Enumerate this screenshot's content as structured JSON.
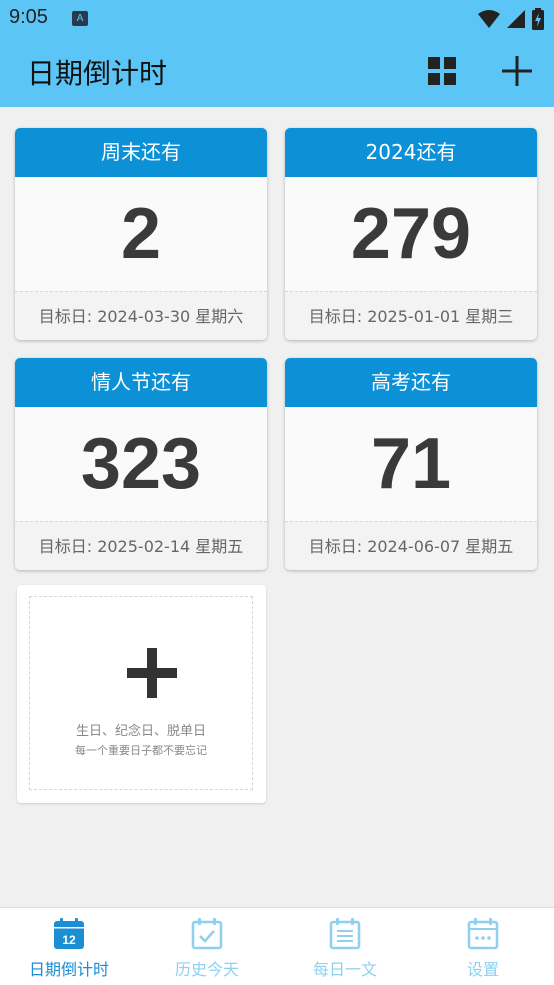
{
  "status": {
    "time": "9:05",
    "notif_badge": "A"
  },
  "appbar": {
    "title": "日期倒计时",
    "grid_icon": "grid-view-icon",
    "add_icon": "plus-icon"
  },
  "colors": {
    "header": "#5bc6f6",
    "card_head": "#0c90d6",
    "number": "#3a3a3a",
    "nav_active": "#1a8fd4",
    "nav_inactive": "#8fd0f0"
  },
  "cards": [
    {
      "title": "周末还有",
      "days": "2",
      "target": "目标日: 2024-03-30 星期六"
    },
    {
      "title": "2024还有",
      "days": "279",
      "target": "目标日: 2025-01-01 星期三"
    },
    {
      "title": "情人节还有",
      "days": "323",
      "target": "目标日: 2025-02-14 星期五"
    },
    {
      "title": "高考还有",
      "days": "71",
      "target": "目标日: 2024-06-07 星期五"
    }
  ],
  "add_card": {
    "line1": "生日、纪念日、脱单日",
    "line2": "每一个重要日子都不要忘记"
  },
  "nav": [
    {
      "label": "日期倒计时",
      "icon": "calendar-12-icon",
      "active": true,
      "badge": "12"
    },
    {
      "label": "历史今天",
      "icon": "calendar-check-icon",
      "active": false
    },
    {
      "label": "每日一文",
      "icon": "calendar-lines-icon",
      "active": false
    },
    {
      "label": "设置",
      "icon": "calendar-dots-icon",
      "active": false
    }
  ]
}
